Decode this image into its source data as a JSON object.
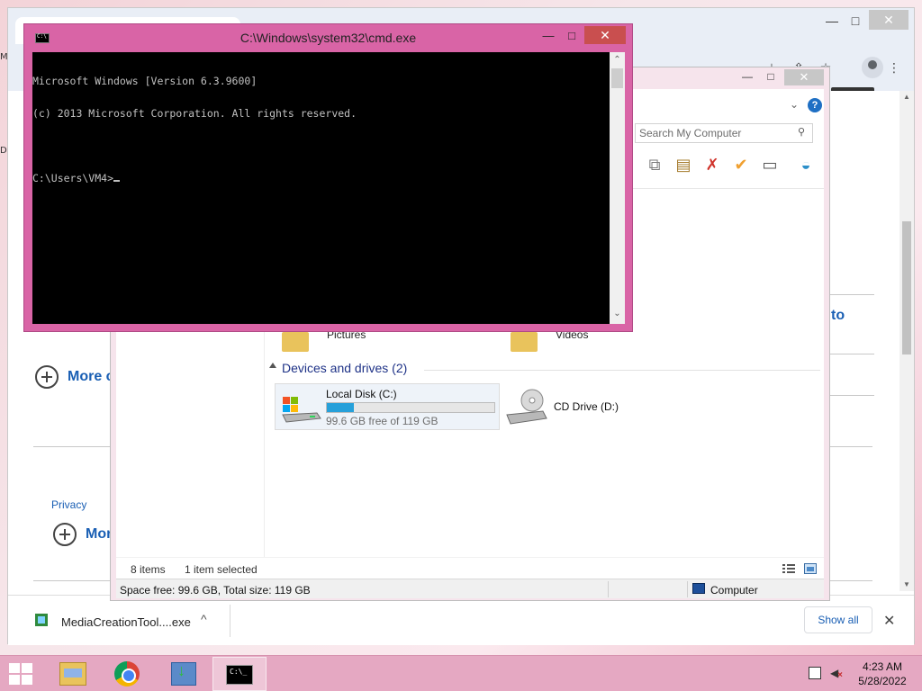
{
  "desktop": {
    "edge_glyph_top": "M",
    "edge_glyph_mid": "D"
  },
  "chrome": {
    "minimize": "—",
    "maximize": "□",
    "close": "✕",
    "page": {
      "more_label_1": "More c",
      "more_label_2": "More",
      "privacy": "Privacy",
      "to_fragment": "to"
    },
    "download": {
      "file_name": "MediaCreationTool....exe",
      "show_all": "Show all",
      "close": "✕",
      "chevron": "^"
    }
  },
  "explorer": {
    "search_placeholder": "Search My Computer",
    "help": "?",
    "groups": {
      "folders": {
        "pictures": "Pictures",
        "videos": "Videos"
      },
      "devices_header": "Devices and drives (2)"
    },
    "drives": [
      {
        "name": "Local Disk (C:)",
        "free_text": "99.6 GB free of 119 GB",
        "used_fraction": 0.163
      },
      {
        "name": "CD Drive (D:)"
      }
    ],
    "status": {
      "items": "8 items",
      "selected": "1 item selected",
      "space": "Space free: 99.6 GB, Total size: 119 GB",
      "location": "Computer"
    }
  },
  "cmd": {
    "title": "C:\\Windows\\system32\\cmd.exe",
    "lines": [
      "Microsoft Windows [Version 6.3.9600]",
      "(c) 2013 Microsoft Corporation. All rights reserved.",
      "",
      "C:\\Users\\VM4>"
    ]
  },
  "taskbar": {
    "clock_time": "4:23 AM",
    "clock_date": "5/28/2022"
  },
  "colors": {
    "cmd_frame": "#d964a6",
    "taskbar": "#e5a8c2",
    "link_blue": "#1a5fb4",
    "disk_fill": "#26a0da"
  }
}
